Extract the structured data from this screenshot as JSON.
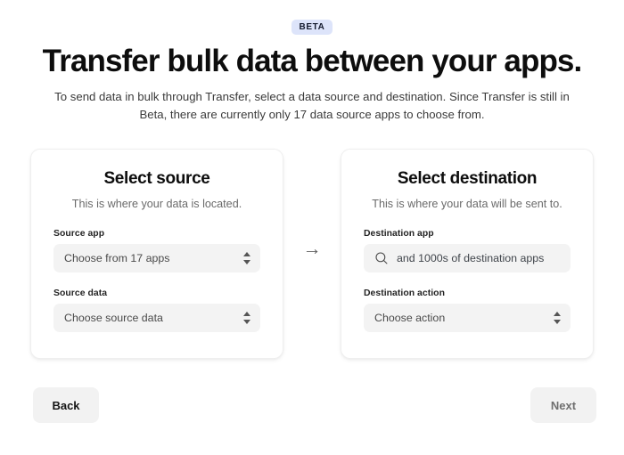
{
  "header": {
    "badge": "BETA",
    "title": "Transfer bulk data between your apps.",
    "subtitle": "To send data in bulk through Transfer, select a data source and destination. Since Transfer is still in Beta, there are currently only 17 data source apps to choose from."
  },
  "source_card": {
    "title": "Select source",
    "subtitle": "This is where your data is located.",
    "app_field": {
      "label": "Source app",
      "value": "Choose from 17 apps",
      "icon": "select-caret-icon"
    },
    "data_field": {
      "label": "Source data",
      "value": "Choose source data",
      "icon": "select-caret-icon"
    }
  },
  "separator": {
    "icon": "arrow-right-icon",
    "glyph": "→"
  },
  "destination_card": {
    "title": "Select destination",
    "subtitle": "This is where your data will be sent to.",
    "app_field": {
      "label": "Destination app",
      "placeholder": "and 1000s of destination apps",
      "value": "",
      "icon": "search-icon"
    },
    "action_field": {
      "label": "Destination action",
      "value": "Choose action",
      "icon": "select-caret-icon"
    }
  },
  "footer": {
    "back_label": "Back",
    "next_label": "Next"
  },
  "colors": {
    "badge_background": "#dde4fa",
    "badge_text": "#151b2e",
    "page_background": "#ffffff",
    "card_background": "#ffffff",
    "card_border": "#efefef",
    "field_background": "#f3f3f3",
    "button_background": "#f2f2f2",
    "next_text": "#6f6f6f"
  }
}
